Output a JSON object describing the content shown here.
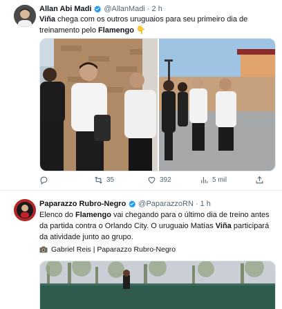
{
  "tweets": [
    {
      "author": {
        "name": "Allan Abi Madi",
        "handle": "@AllanMadi",
        "time": "2 h"
      },
      "text": {
        "part1": "Viña",
        "part2": " chega com os outros uruguaios para seu primeiro dia de treinamento pelo ",
        "part3": "Flamengo",
        "part4": " 👇"
      },
      "actions": {
        "replies": "",
        "retweets": "35",
        "likes": "392",
        "views": "5 mil"
      }
    },
    {
      "author": {
        "name": "Paparazzo Rubro-Negro",
        "handle": "@PaparazzoRN",
        "time": "1 h"
      },
      "text": {
        "part1": "Elenco do ",
        "part2": "Flamengo",
        "part3": " vai chegando para o último dia de treino antes da partida contra o Orlando City. O uruguaio Matías ",
        "part4": "Viña",
        "part5": " participará da atividade junto ao grupo."
      },
      "credit": "Gabriel Reis | Paparazzo Rubro-Negro"
    }
  ],
  "icons": {
    "verified": "verified-badge-icon",
    "reply": "reply-icon",
    "retweet": "retweet-icon",
    "like": "heart-icon",
    "views": "views-icon",
    "share": "share-icon",
    "camera": "camera-icon"
  },
  "colors": {
    "verified": "#1d9bf0",
    "secondary_text": "#536471",
    "divider": "#e6ecf0"
  }
}
